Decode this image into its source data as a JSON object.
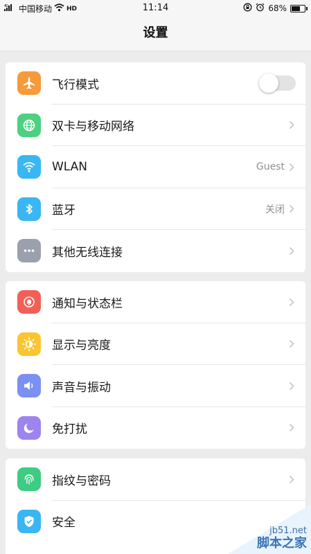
{
  "status_bar": {
    "network_tag": "4G",
    "carrier": "中国移动",
    "volte": "HD",
    "time": "11:14",
    "battery_percent": "68%",
    "battery_level": 0.68
  },
  "nav": {
    "title": "设置"
  },
  "groups": [
    {
      "items": [
        {
          "id": "airplane",
          "label": "飞行模式",
          "icon": "airplane-icon",
          "icon_color": "#f79a3b",
          "control": "toggle",
          "toggle_on": false
        },
        {
          "id": "dual-sim",
          "label": "双卡与移动网络",
          "icon": "globe-icon",
          "icon_color": "#4cd17f",
          "control": "chevron"
        },
        {
          "id": "wlan",
          "label": "WLAN",
          "value": "Guest",
          "icon": "wifi-icon",
          "icon_color": "#3ab6f3",
          "control": "chevron"
        },
        {
          "id": "bluetooth",
          "label": "蓝牙",
          "value": "关闭",
          "icon": "bluetooth-icon",
          "icon_color": "#3ab6f3",
          "control": "chevron"
        },
        {
          "id": "other-wireless",
          "label": "其他无线连接",
          "icon": "more-dots-icon",
          "icon_color": "#9aa1ad",
          "control": "chevron"
        }
      ]
    },
    {
      "items": [
        {
          "id": "notification",
          "label": "通知与状态栏",
          "icon": "bell-icon",
          "icon_color": "#f35f56",
          "control": "chevron"
        },
        {
          "id": "display",
          "label": "显示与亮度",
          "icon": "brightness-icon",
          "icon_color": "#fbc531",
          "control": "chevron"
        },
        {
          "id": "sound",
          "label": "声音与振动",
          "icon": "speaker-icon",
          "icon_color": "#7c8ff3",
          "control": "chevron"
        },
        {
          "id": "dnd",
          "label": "免打扰",
          "icon": "moon-icon",
          "icon_color": "#9d84f0",
          "control": "chevron"
        }
      ]
    },
    {
      "items": [
        {
          "id": "fingerprint",
          "label": "指纹与密码",
          "icon": "fingerprint-icon",
          "icon_color": "#3dcc82",
          "control": "chevron"
        },
        {
          "id": "security",
          "label": "安全",
          "icon": "shield-icon",
          "icon_color": "#3ab6f3",
          "control": "chevron"
        }
      ]
    }
  ],
  "watermark": {
    "url": "jb51.net",
    "text": "脚本之家"
  }
}
